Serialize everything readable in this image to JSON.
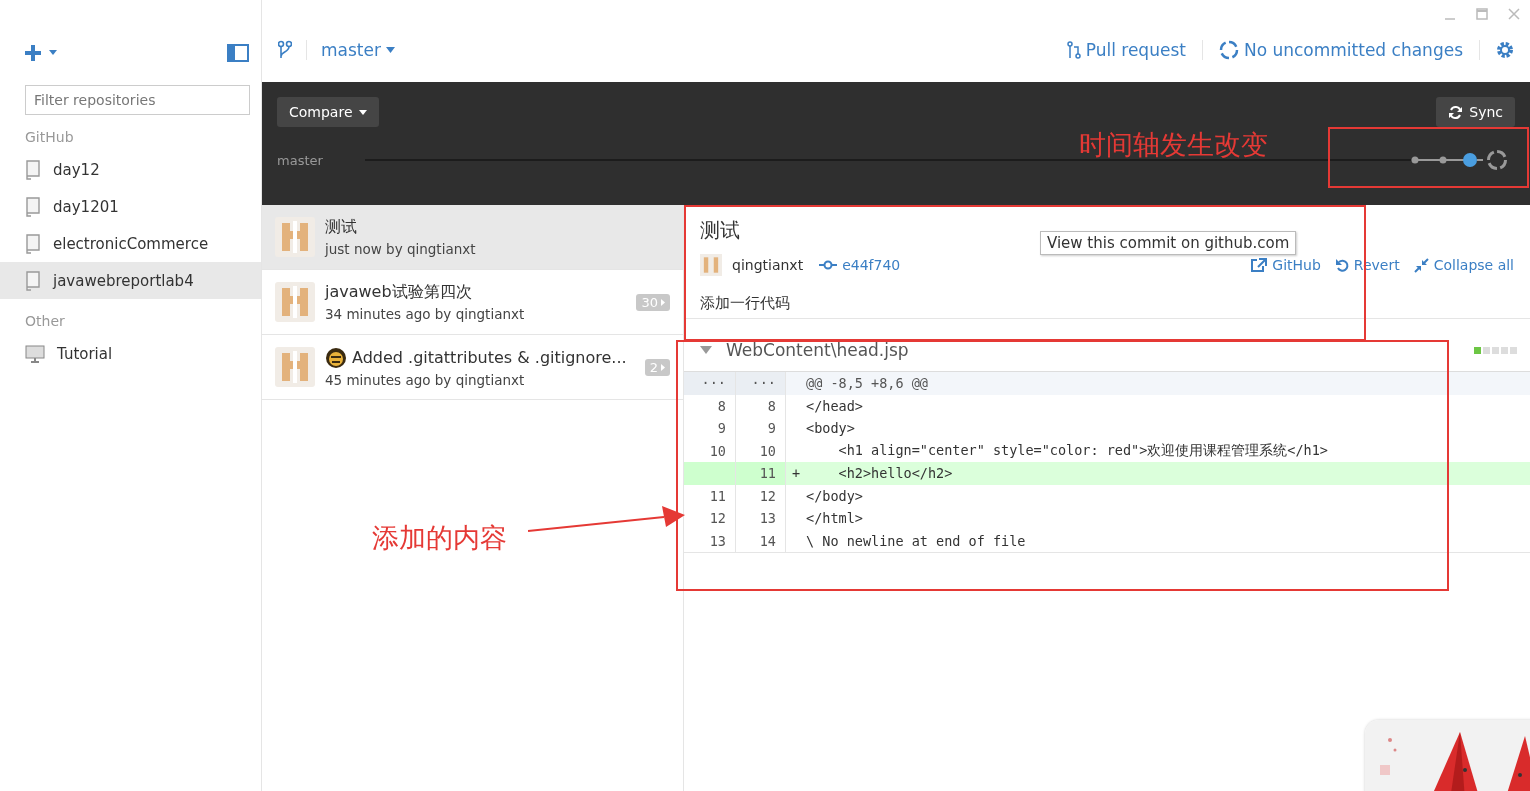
{
  "sidebar": {
    "filter_placeholder": "Filter repositories",
    "groups": [
      {
        "title": "GitHub",
        "items": [
          {
            "name": "day12",
            "kind": "repo",
            "selected": false
          },
          {
            "name": "day1201",
            "kind": "repo",
            "selected": false
          },
          {
            "name": "electronicCommerce",
            "kind": "repo",
            "selected": false
          },
          {
            "name": "javawebreportlab4",
            "kind": "repo",
            "selected": true
          }
        ]
      },
      {
        "title": "Other",
        "items": [
          {
            "name": "Tutorial",
            "kind": "tutorial",
            "selected": false
          }
        ]
      }
    ]
  },
  "toolbar": {
    "branch": "master",
    "pull_request": "Pull request",
    "status": "No uncommitted changes"
  },
  "timeline_bar": {
    "compare": "Compare",
    "sync": "Sync",
    "branch_label": "master"
  },
  "commits": [
    {
      "title": "测试",
      "meta": "just now by qingtianxt",
      "selected": true
    },
    {
      "title": "javaweb试验第四次",
      "meta": "34 minutes ago by qingtianxt",
      "badge": "30",
      "selected": false
    },
    {
      "title": "Added .gitattributes & .gitignore...",
      "meta": "45 minutes ago by qingtianxt",
      "badge": "2",
      "emoji_icon": true,
      "selected": false
    }
  ],
  "commit_detail": {
    "title": "测试",
    "author": "qingtianxt",
    "sha": "e44f740",
    "message": "添加一行代码",
    "tooltip": "View this commit on github.com",
    "actions": [
      {
        "kind": "github",
        "label": "GitHub"
      },
      {
        "kind": "revert",
        "label": "Revert"
      },
      {
        "kind": "collapse",
        "label": "Collapse all"
      }
    ]
  },
  "diff": {
    "file": "WebContent\\head.jsp",
    "expanded": true,
    "hunk": {
      "old": "···",
      "new": "···",
      "text": "@@ -8,5 +8,6 @@"
    },
    "lines": [
      {
        "kind": "context",
        "old": "8",
        "new": "8",
        "text": "</head>"
      },
      {
        "kind": "context",
        "old": "9",
        "new": "9",
        "text": "<body>"
      },
      {
        "kind": "context",
        "old": "10",
        "new": "10",
        "text": "    <h1 align=\"center\" style=\"color: red\">欢迎使用课程管理系统</h1>"
      },
      {
        "kind": "added",
        "new": "11",
        "marker": "+",
        "text": "    <h2>hello</h2>"
      },
      {
        "kind": "context",
        "old": "11",
        "new": "12",
        "text": "</body>"
      },
      {
        "kind": "context",
        "old": "12",
        "new": "13",
        "text": "</html>"
      },
      {
        "kind": "context",
        "old": "13",
        "new": "14",
        "text": "\\ No newline at end of file"
      }
    ]
  },
  "annotations": [
    {
      "kind": "timeline",
      "text": "时间轴发生改变"
    },
    {
      "kind": "content",
      "text": "添加的内容"
    }
  ]
}
